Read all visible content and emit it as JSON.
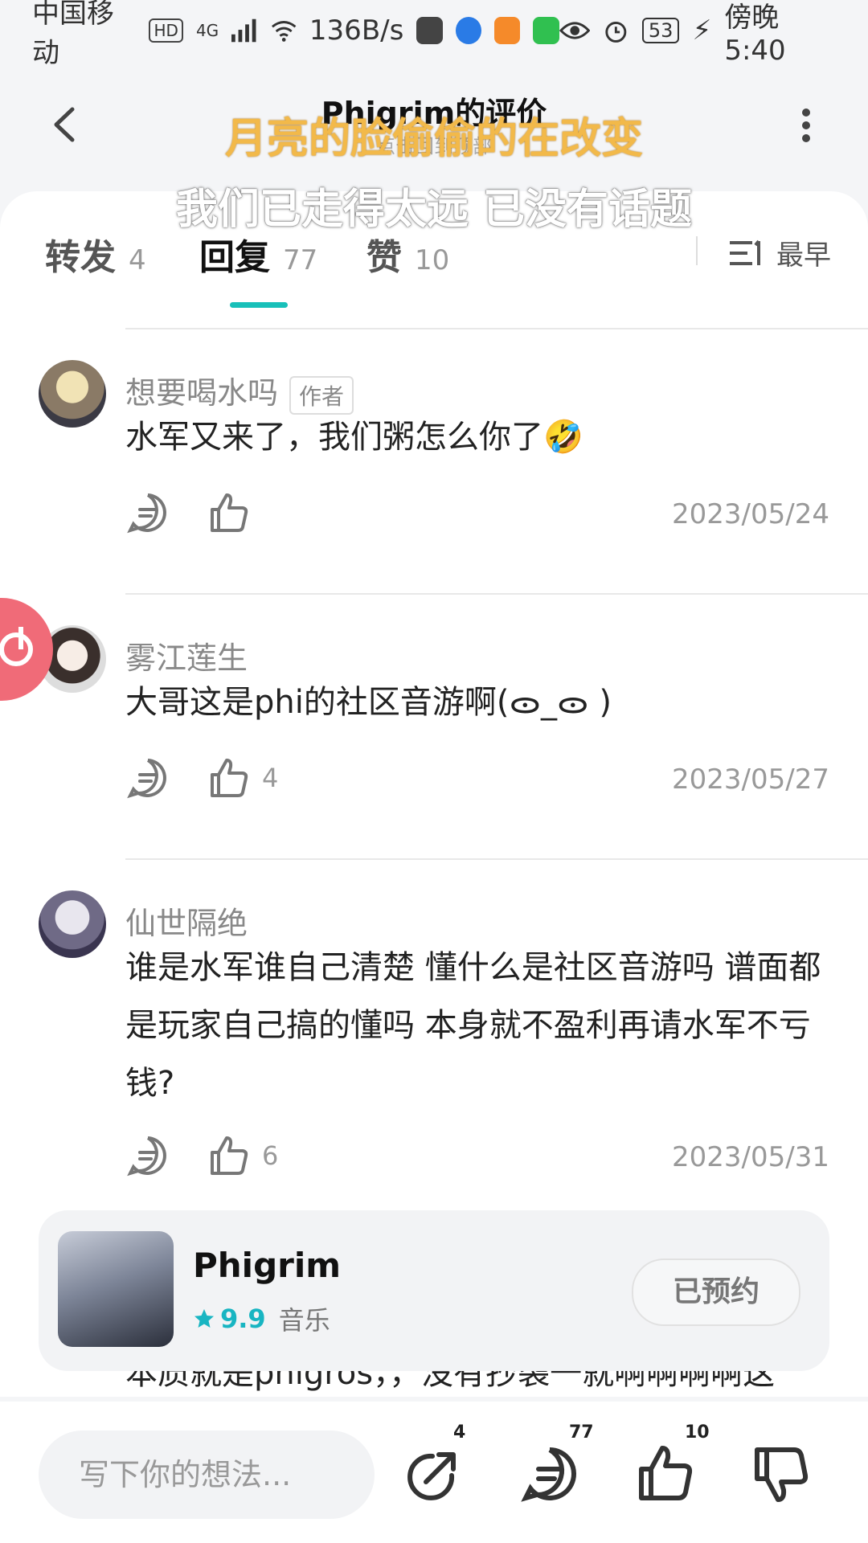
{
  "status_bar": {
    "carrier": "中国移动",
    "hd_badge": "HD",
    "network_label": "4G",
    "net_speed": "136B/s",
    "battery": "53",
    "time": "傍晚5:40",
    "app_icons": [
      "huawei-appgallery-icon",
      "browser-icon",
      "video-icon",
      "message-icon"
    ]
  },
  "header": {
    "title": "Phigrim的评价",
    "subtitle": "点击回到顶部",
    "lyric_line1": "月亮的脸偷偷的在改变",
    "lyric_line2": "我们已走得太远 已没有话题"
  },
  "tabs": [
    {
      "label": "转发",
      "count": "4"
    },
    {
      "label": "回复",
      "count": "77"
    },
    {
      "label": "赞",
      "count": "10"
    }
  ],
  "sort": {
    "label": "最早"
  },
  "comments": [
    {
      "user": "想要喝水吗",
      "badge": "作者",
      "text": "水军又来了，我们粥怎么你了🤣",
      "likes": "",
      "date": "2023/05/24"
    },
    {
      "user": "雾江莲生",
      "badge": "",
      "text": "大哥这是phi的社区音游啊(ᯣ_ᯣ )",
      "likes": "4",
      "date": "2023/05/27"
    },
    {
      "user": "仙世隔绝",
      "badge": "",
      "text": "谁是水军谁自己清楚 懂什么是社区音游吗 谱面都是玩家自己搞的懂吗 本身就不盈利再请水军不亏钱?",
      "likes": "6",
      "date": "2023/05/31"
    }
  ],
  "clipped_comment_text": "本质就是phigros，，没有抄袭一就啊啊啊啊这",
  "game_card": {
    "name": "Phigrim",
    "rating": "9.9",
    "category": "音乐",
    "button_label": "已预约"
  },
  "bottom_bar": {
    "input_placeholder": "写下你的想法...",
    "share_count": "4",
    "comment_count": "77",
    "like_count": "10"
  },
  "colors": {
    "accent": "#18c0b9",
    "rating": "#18b5c2",
    "lyric": "#f2b94a"
  }
}
